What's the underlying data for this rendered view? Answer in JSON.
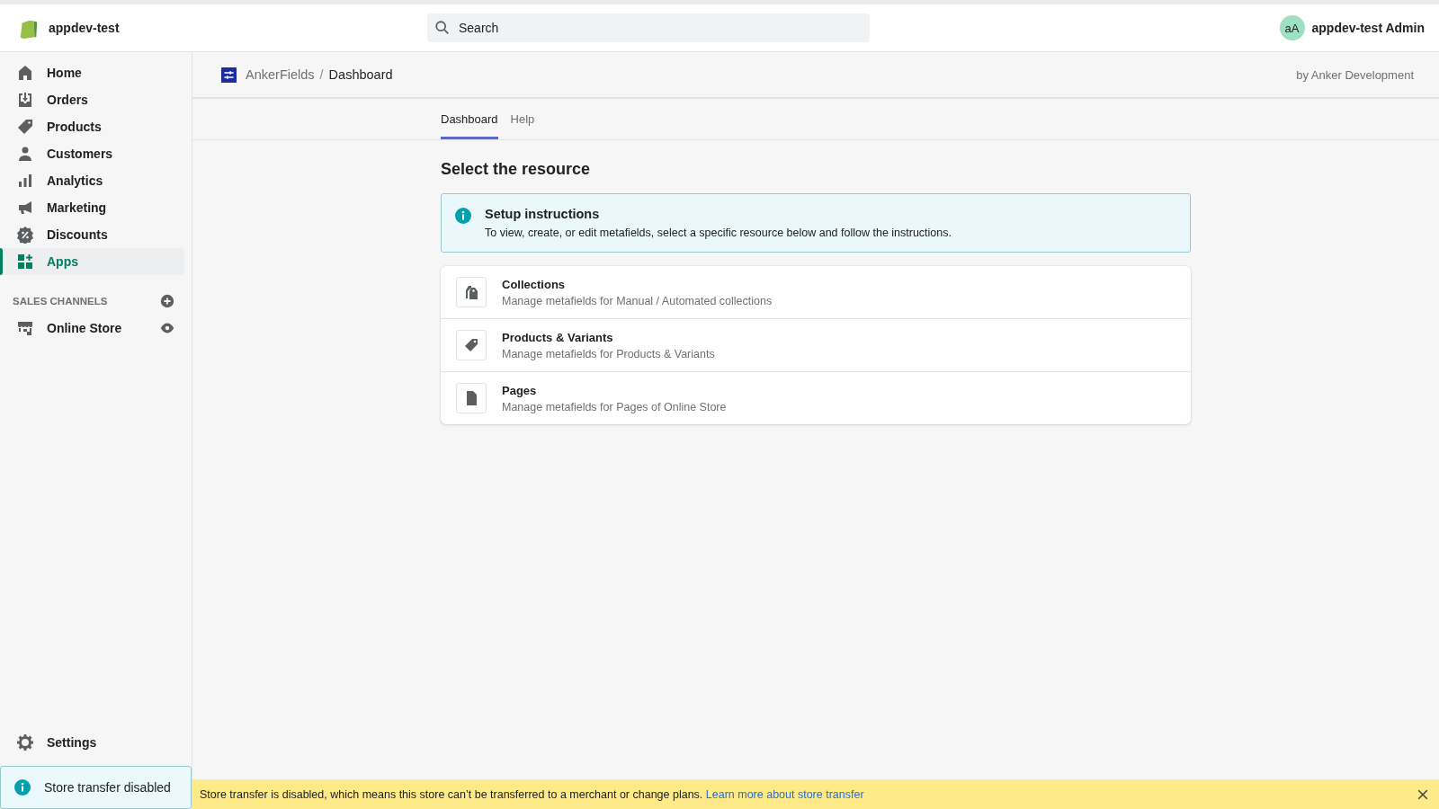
{
  "topbar": {
    "store_name": "appdev-test",
    "search": {
      "placeholder": "Search"
    },
    "user": {
      "initials": "aA",
      "name": "appdev-test Admin"
    }
  },
  "sidebar": {
    "items": [
      {
        "label": "Home",
        "selected": false
      },
      {
        "label": "Orders",
        "selected": false
      },
      {
        "label": "Products",
        "selected": false
      },
      {
        "label": "Customers",
        "selected": false
      },
      {
        "label": "Analytics",
        "selected": false
      },
      {
        "label": "Marketing",
        "selected": false
      },
      {
        "label": "Discounts",
        "selected": false
      },
      {
        "label": "Apps",
        "selected": true
      }
    ],
    "sales_channels": {
      "heading": "SALES CHANNELS",
      "items": [
        {
          "label": "Online Store"
        }
      ]
    },
    "settings": {
      "label": "Settings"
    },
    "notice": {
      "text": "Store transfer disabled"
    }
  },
  "app_header": {
    "breadcrumb": {
      "app": "AnkerFields",
      "separator": "/",
      "page": "Dashboard"
    },
    "byline": "by Anker Development"
  },
  "tabs": [
    {
      "label": "Dashboard",
      "selected": true
    },
    {
      "label": "Help",
      "selected": false
    }
  ],
  "content": {
    "title": "Select the resource",
    "info_banner": {
      "title": "Setup instructions",
      "text": "To view, create, or edit metafields, select a specific resource below and follow the instructions."
    },
    "resources": [
      {
        "kind": "collections",
        "title": "Collections",
        "description": "Manage metafields for Manual / Automated collections"
      },
      {
        "kind": "products",
        "title": "Products & Variants",
        "description": "Manage metafields for Products & Variants"
      },
      {
        "kind": "pages",
        "title": "Pages",
        "description": "Manage metafields for Pages of Online Store"
      }
    ]
  },
  "bottom_banner": {
    "text": "Store transfer is disabled, which means this store can’t be transferred to a merchant or change plans.",
    "link": "Learn more about store transfer"
  }
}
